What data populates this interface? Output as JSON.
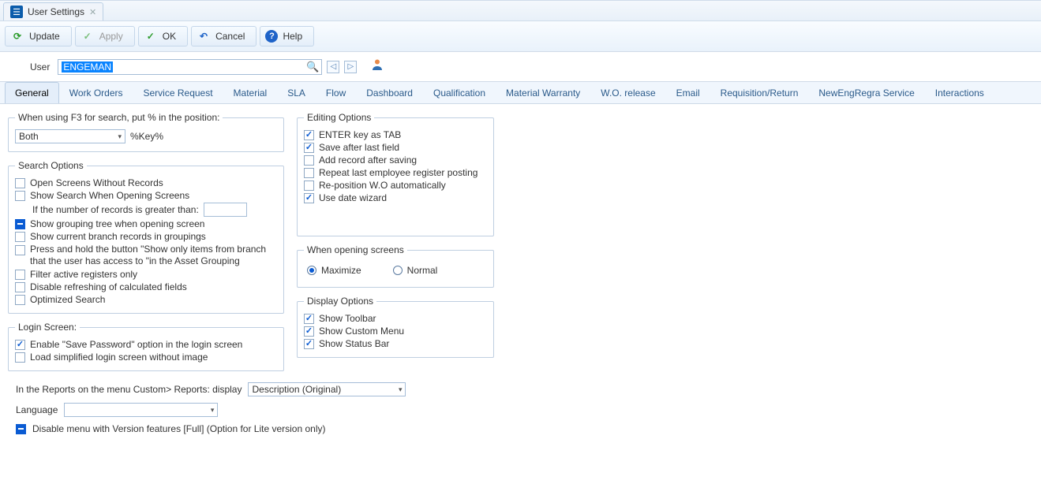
{
  "window": {
    "title": "User Settings"
  },
  "toolbar": {
    "update": "Update",
    "apply": "Apply",
    "ok": "OK",
    "cancel": "Cancel",
    "help": "Help"
  },
  "user": {
    "label": "User",
    "value": "ENGEMAN"
  },
  "tabs": [
    "General",
    "Work Orders",
    "Service Request",
    "Material",
    "SLA",
    "Flow",
    "Dashboard",
    "Qualification",
    "Material Warranty",
    "W.O. release",
    "Email",
    "Requisition/Return",
    "NewEngRegra Service",
    "Interactions"
  ],
  "f3group": {
    "legend": "When using F3 for search, put % in the position:",
    "select": "Both",
    "suffix": "%Key%"
  },
  "searchOptions": {
    "legend": "Search Options",
    "openWithout": "Open Screens Without Records",
    "showSearch": "Show Search When Opening Screens",
    "ifGreater": "If the number of records is greater than:",
    "showGrouping": "Show grouping tree when opening screen",
    "showBranch": "Show current branch records in groupings",
    "pressHold": "Press and hold the button \"Show only items from branch that the user has access to \"in the Asset Grouping",
    "filterActive": "Filter active registers only",
    "disableRefresh": "Disable refreshing of calculated fields",
    "optimized": "Optimized Search"
  },
  "loginScreen": {
    "legend": "Login Screen:",
    "enableSave": "Enable \"Save Password\" option in the login screen",
    "loadSimplified": "Load simplified login screen without image"
  },
  "editing": {
    "legend": "Editing Options",
    "enterTab": "ENTER key as TAB",
    "saveAfter": "Save after last field",
    "addAfter": "Add record after saving",
    "repeatLast": "Repeat last employee register posting",
    "reposition": "Re-position W.O automatically",
    "dateWizard": "Use date wizard"
  },
  "openScreens": {
    "legend": "When opening screens",
    "maximize": "Maximize",
    "normal": "Normal"
  },
  "display": {
    "legend": "Display Options",
    "toolbar": "Show Toolbar",
    "custom": "Show Custom Menu",
    "status": "Show Status Bar"
  },
  "reportsLine": {
    "label": "In the Reports on the menu Custom> Reports: display",
    "value": "Description (Original)"
  },
  "languageLine": {
    "label": "Language"
  },
  "disableMenu": "Disable menu with Version features [Full] (Option for Lite version only)"
}
